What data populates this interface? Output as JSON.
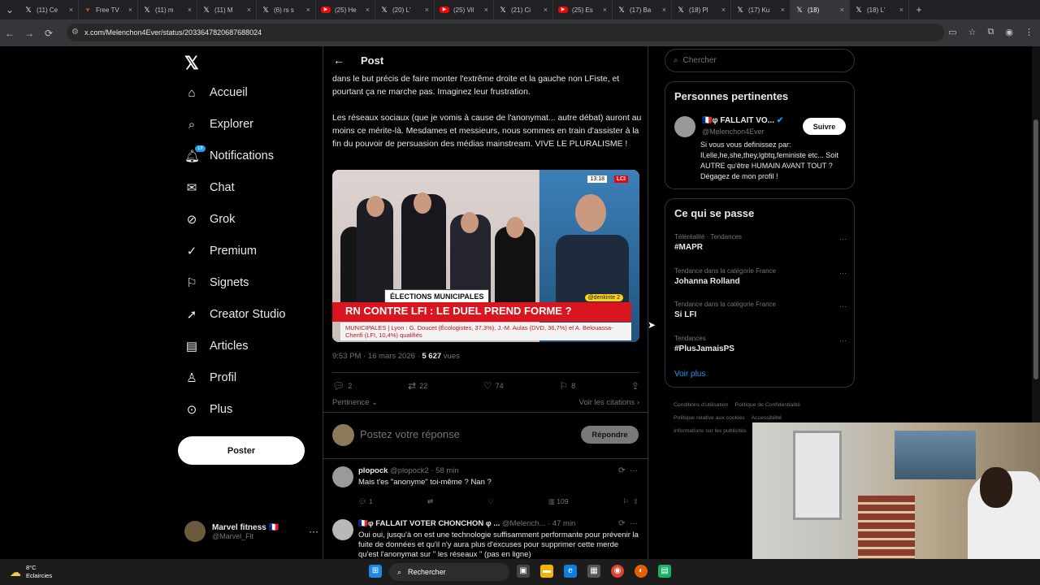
{
  "browser": {
    "tabs": [
      {
        "label": "(11) Ce",
        "icon": "x"
      },
      {
        "label": "Free TV",
        "icon": "free"
      },
      {
        "label": "(11) m",
        "icon": "x"
      },
      {
        "label": "(11) M",
        "icon": "x"
      },
      {
        "label": "(6) rs s",
        "icon": "x"
      },
      {
        "label": "(25) He",
        "icon": "yt"
      },
      {
        "label": "(20) L'",
        "icon": "x"
      },
      {
        "label": "(25) Vil",
        "icon": "yt"
      },
      {
        "label": "(21) Ci",
        "icon": "x"
      },
      {
        "label": "(25) Es",
        "icon": "yt"
      },
      {
        "label": "(17) Ba",
        "icon": "x"
      },
      {
        "label": "(18) Pl",
        "icon": "x"
      },
      {
        "label": "(17) Ku",
        "icon": "x"
      },
      {
        "label": "(18)",
        "icon": "x",
        "active": true
      },
      {
        "label": "(18) L'",
        "icon": "x"
      }
    ],
    "url": "x.com/Melenchon4Ever/status/2033647820687688024"
  },
  "nav": {
    "items": [
      {
        "label": "Accueil",
        "icon": "home-icon"
      },
      {
        "label": "Explorer",
        "icon": "search-icon"
      },
      {
        "label": "Notifications",
        "icon": "bell-icon",
        "badge": "18"
      },
      {
        "label": "Chat",
        "icon": "mail-icon"
      },
      {
        "label": "Grok",
        "icon": "grok-icon"
      },
      {
        "label": "Premium",
        "icon": "verified-icon"
      },
      {
        "label": "Signets",
        "icon": "bookmark-icon"
      },
      {
        "label": "Creator Studio",
        "icon": "rocket-icon"
      },
      {
        "label": "Articles",
        "icon": "article-icon"
      },
      {
        "label": "Profil",
        "icon": "person-icon"
      },
      {
        "label": "Plus",
        "icon": "more-circle-icon"
      }
    ],
    "post_button": "Poster",
    "account": {
      "name": "Marvel fitness 🇫🇷",
      "handle": "@Marvel_Flt"
    }
  },
  "post": {
    "header_title": "Post",
    "text_p1": "dans le but précis de faire monter l'extrême droite et la gauche non LFiste, et pourtant ça ne marche pas. Imaginez leur frustration.",
    "text_p2": "Les réseaux sociaux (que je vomis à cause de l'anonymat... autre débat) auront au moins ce mérite-là. Mesdames et messieurs, nous sommes en train d'assister à la fin du pouvoir de persuasion des médias mainstream. VIVE LE PLURALISME !",
    "media": {
      "tag": "ÉLECTIONS MUNICIPALES",
      "headline": "RN CONTRE LFI : LE DUEL PREND FORME ?",
      "subline": "MUNICIPALES | Lyon : G. Doucet (Écologistes, 37,3%), J.-M. Aulas (DVD, 36,7%) et A. Belouassa-Cherifi (LFI, 10,4%) qualifiés",
      "channel": "LCI",
      "time": "13:18",
      "handle": "@denkinte 2"
    },
    "time": "9:53 PM · 16 mars 2026 ·",
    "views_num": "5 627",
    "views_label": "vues",
    "replies": "2",
    "reposts": "22",
    "likes": "74",
    "bookmarks": "8",
    "sort_label": "Pertinence",
    "quotes_label": "Voir les citations"
  },
  "reply_box": {
    "placeholder": "Postez votre réponse",
    "button": "Répondre"
  },
  "comments": [
    {
      "name": "plopock",
      "handle": "@plopock2 · 58 min",
      "text": "Mais t'es \"anonyme\" toi-même ? Nan ?",
      "replies": "1",
      "views": "109"
    },
    {
      "name": "🇫🇷φ FALLAIT VOTER CHONCHON φ ...",
      "handle": "@Melench... · 47 min",
      "text": "Oui oui, jusqu'à on est une technologie suffisamment performante pour prévenir la fuite de données et qu'il n'y aura plus d'excuses pour supprimer cette merde qu'est l'anonymat sur \" les réseaux \" (pas en ligne)"
    }
  ],
  "sidebar": {
    "search_placeholder": "Chercher",
    "people_title": "Personnes pertinentes",
    "person": {
      "name": "🇫🇷φ FALLAIT VO...",
      "handle": "@Melenchon4Ever",
      "follow": "Suivre",
      "bio": "Si vous vous definissez par: Il,elle,he,she,they,lgbtq,feministe etc... Soit AUTRE qu'être HUMAIN AVANT TOUT ? Dégagez de mon profil !"
    },
    "trends_title": "Ce qui se passe",
    "trends": [
      {
        "category": "Téléréalité · Tendances",
        "name": "#MAPR"
      },
      {
        "category": "Tendance dans la catégorie France",
        "name": "Johanna Rolland"
      },
      {
        "category": "Tendance dans la catégorie France",
        "name": "Si LFI"
      },
      {
        "category": "Tendances",
        "name": "#PlusJamaisPS"
      }
    ],
    "see_more": "Voir plus",
    "footer": [
      "Conditions d'utilisation",
      "Politique de Confidentialité",
      "Politique relative aux cookies",
      "Accessibilité",
      "Informations sur les publicités"
    ]
  },
  "taskbar": {
    "temp": "8°C",
    "weather": "Eclaircies",
    "search": "Rechercher"
  }
}
